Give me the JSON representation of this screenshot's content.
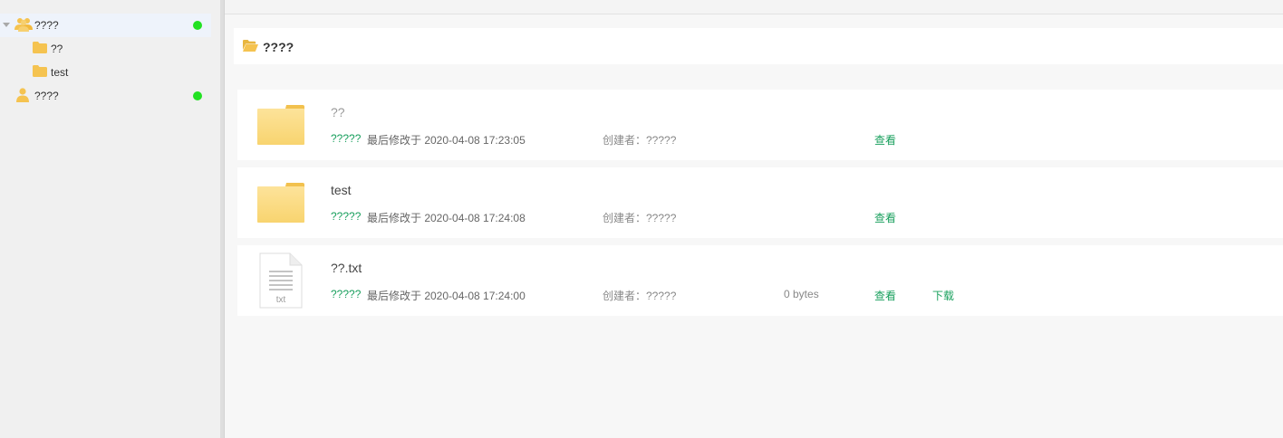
{
  "sidebar": {
    "items": [
      {
        "label": "????",
        "icon": "users-icon",
        "expanded": true,
        "online": true
      },
      {
        "label": "??",
        "icon": "folder-icon"
      },
      {
        "label": "test",
        "icon": "folder-icon"
      },
      {
        "label": "????",
        "icon": "user-icon",
        "online": true
      }
    ]
  },
  "header": {
    "title": "????",
    "icon": "folder-open-icon"
  },
  "files": [
    {
      "name": "??",
      "type": "folder",
      "owner": "?????",
      "modified": "最后修改于 2020-04-08 17:23:05",
      "creator": "创建者：?????",
      "size": "",
      "view_label": "查看"
    },
    {
      "name": "test",
      "type": "folder",
      "owner": "?????",
      "modified": "最后修改于 2020-04-08 17:24:08",
      "creator": "创建者：?????",
      "size": "",
      "view_label": "查看"
    },
    {
      "name": "??.txt",
      "type": "txt",
      "file_ext": "txt",
      "owner": "?????",
      "modified": "最后修改于 2020-04-08 17:24:00",
      "creator": "创建者：?????",
      "size": "0 bytes",
      "view_label": "查看",
      "download_label": "下载"
    }
  ],
  "colors": {
    "accent_green": "#1aa05e",
    "status_online": "#22e122",
    "folder_yellow": "#f6cf63",
    "selected_bg": "#eef3fb"
  }
}
